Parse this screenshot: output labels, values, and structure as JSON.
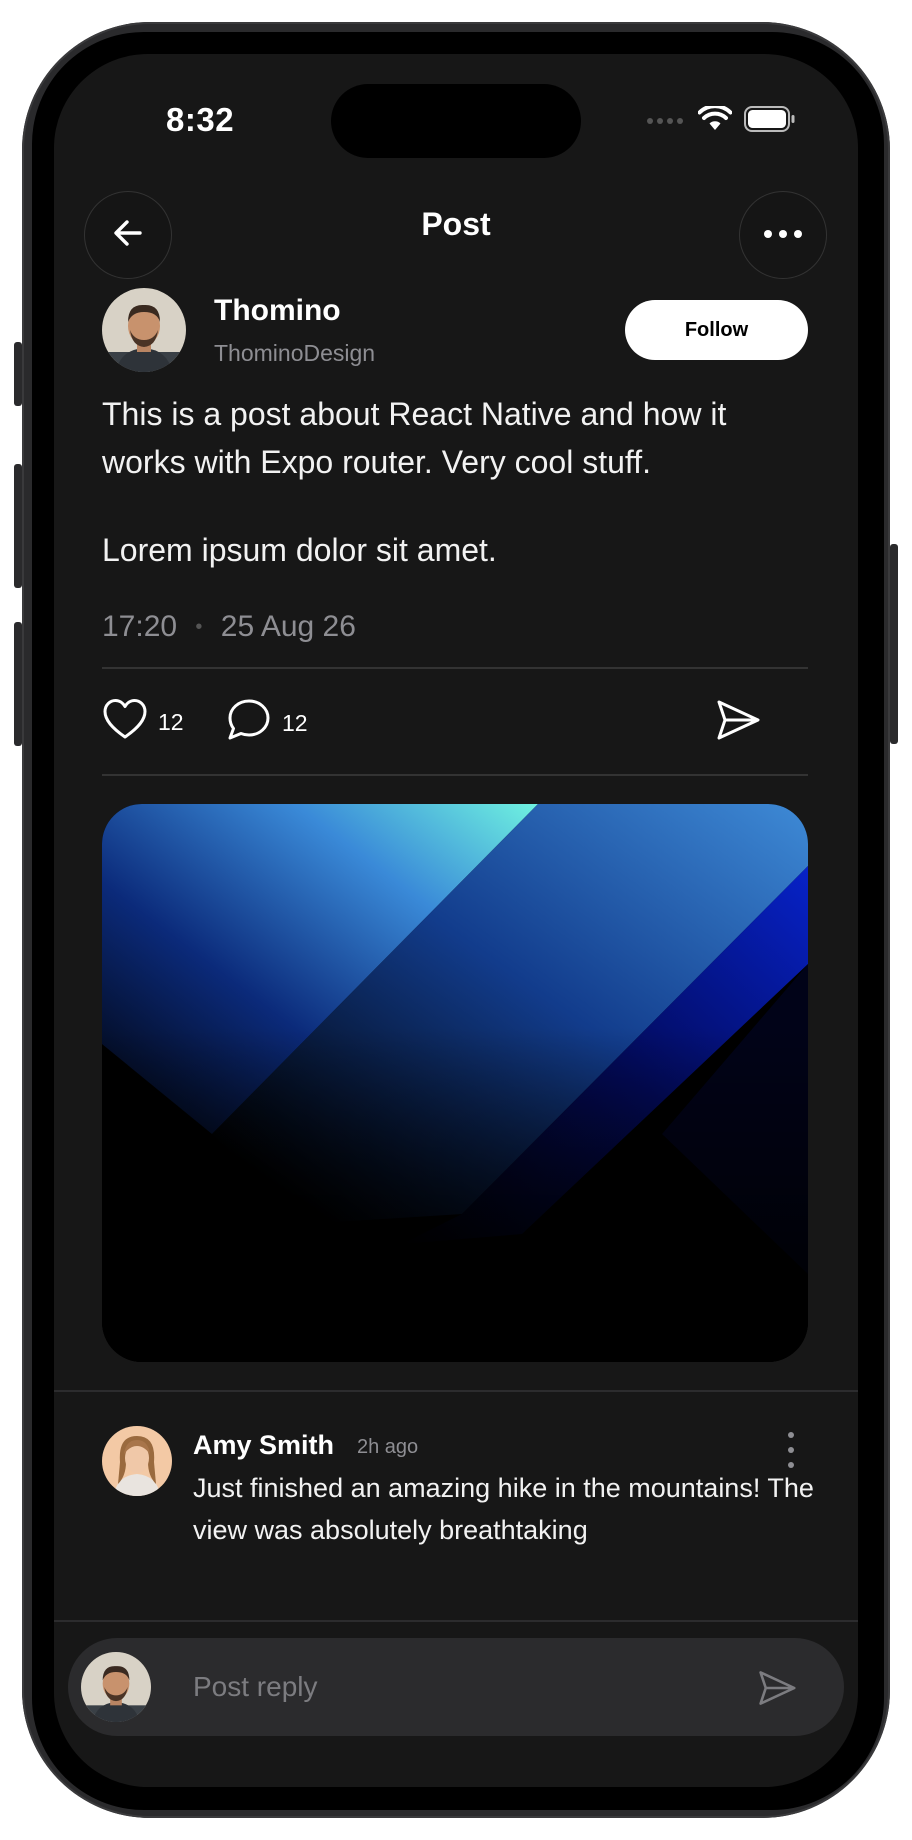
{
  "status_bar": {
    "time": "8:32"
  },
  "header": {
    "title": "Post",
    "back_icon": "arrow-left-icon",
    "more_icon": "ellipsis-icon"
  },
  "author": {
    "name": "Thomino",
    "handle": "ThominoDesign",
    "follow_label": "Follow"
  },
  "post": {
    "paragraphs": [
      "This is a post about React Native and how it works with Expo router. Very cool stuff.",
      "Lorem ipsum dolor sit amet."
    ],
    "time": "17:20",
    "separator": "•",
    "date": "25 Aug 26",
    "likes": "12",
    "comments": "12"
  },
  "comment": {
    "name": "Amy Smith",
    "time": "2h ago",
    "text": "Just finished an amazing hike in the mountains! The view was absolutely breathtaking"
  },
  "reply": {
    "placeholder": "Post reply"
  },
  "colors": {
    "background": "#171717",
    "accent": "#ffffff",
    "muted": "#8e8e93",
    "input": "#2b2b2d"
  }
}
